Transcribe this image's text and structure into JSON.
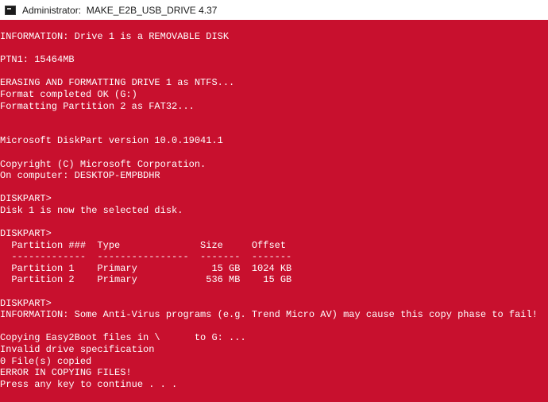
{
  "window": {
    "title_prefix": "Administrator:  ",
    "title": "MAKE_E2B_USB_DRIVE 4.37",
    "console_bg": "#c8102e",
    "console_fg": "#ffffff",
    "icon": "console-icon"
  },
  "console": {
    "lines": [
      "INFORMATION: Drive 1 is a REMOVABLE DISK",
      "",
      "PTN1: 15464MB",
      "",
      "ERASING AND FORMATTING DRIVE 1 as NTFS...",
      "Format completed OK (G:)",
      "Formatting Partition 2 as FAT32...",
      "",
      "",
      "Microsoft DiskPart version 10.0.19041.1",
      "",
      "Copyright (C) Microsoft Corporation.",
      "On computer: DESKTOP-EMPBDHR",
      "",
      "DISKPART>",
      "Disk 1 is now the selected disk.",
      "",
      "DISKPART>",
      "  Partition ###  Type              Size     Offset",
      "  -------------  ----------------  -------  -------",
      "  Partition 1    Primary             15 GB  1024 KB",
      "  Partition 2    Primary            536 MB    15 GB",
      "",
      "DISKPART>",
      "INFORMATION: Some Anti-Virus programs (e.g. Trend Micro AV) may cause this copy phase to fail!",
      "",
      "Copying Easy2Boot files in \\      to G: ...",
      "Invalid drive specification",
      "0 File(s) copied",
      "ERROR IN COPYING FILES!",
      "Press any key to continue . . ."
    ]
  }
}
